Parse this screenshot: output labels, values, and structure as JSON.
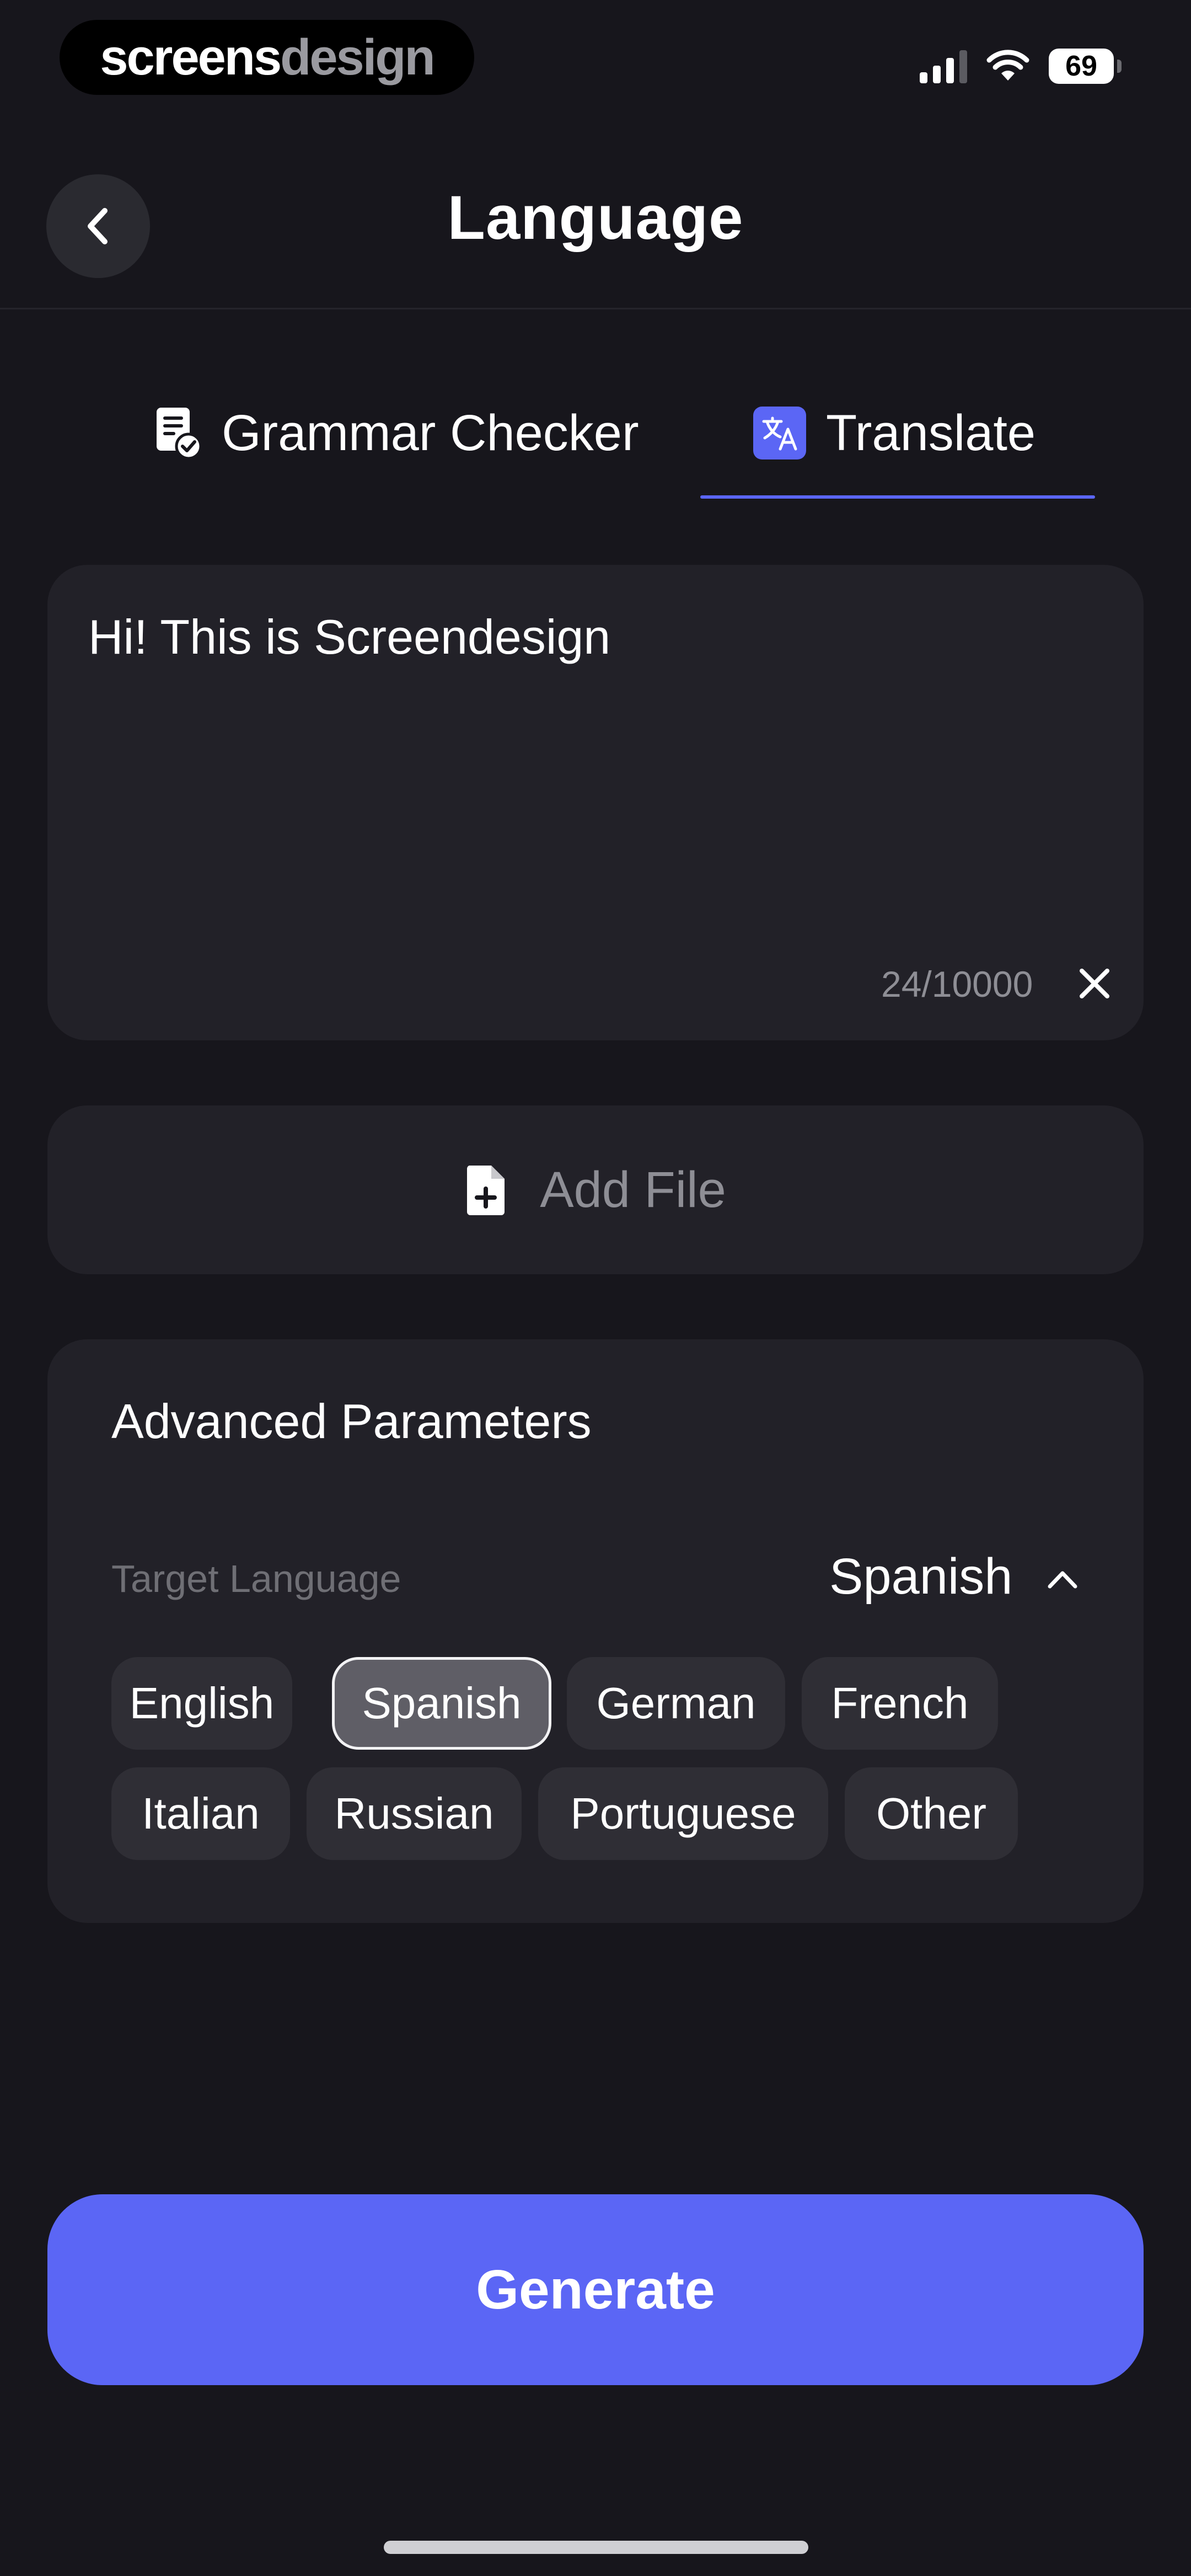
{
  "status_bar": {
    "brand_part1": "screens",
    "brand_part2": "design",
    "battery": "69",
    "signal_icon": "signal-bars-icon",
    "wifi_icon": "wifi-icon"
  },
  "header": {
    "title": "Language",
    "back_icon": "chevron-left-icon"
  },
  "tabs": [
    {
      "label": "Grammar Checker",
      "icon": "document-check-icon",
      "active": false
    },
    {
      "label": "Translate",
      "icon": "translate-icon",
      "active": true
    }
  ],
  "input": {
    "value": "Hi! This is Screendesign",
    "counter": "24/10000",
    "clear_icon": "close-icon"
  },
  "add_file": {
    "label": "Add File",
    "icon": "file-plus-icon"
  },
  "advanced": {
    "title": "Advanced Parameters",
    "target_label": "Target Language",
    "target_value": "Spanish",
    "toggle_icon": "chevron-up-icon",
    "languages": [
      {
        "label": "English",
        "selected": false
      },
      {
        "label": "Spanish",
        "selected": true
      },
      {
        "label": "German",
        "selected": false
      },
      {
        "label": "French",
        "selected": false
      },
      {
        "label": "Italian",
        "selected": false
      },
      {
        "label": "Russian",
        "selected": false
      },
      {
        "label": "Portuguese",
        "selected": false
      },
      {
        "label": "Other",
        "selected": false
      }
    ]
  },
  "generate": {
    "label": "Generate"
  },
  "colors": {
    "background": "#17161c",
    "card": "#222128",
    "accent": "#5b66f5",
    "chip": "#2f2e35",
    "chip_selected": "#5f5e66",
    "muted_text": "#8e8e95"
  }
}
